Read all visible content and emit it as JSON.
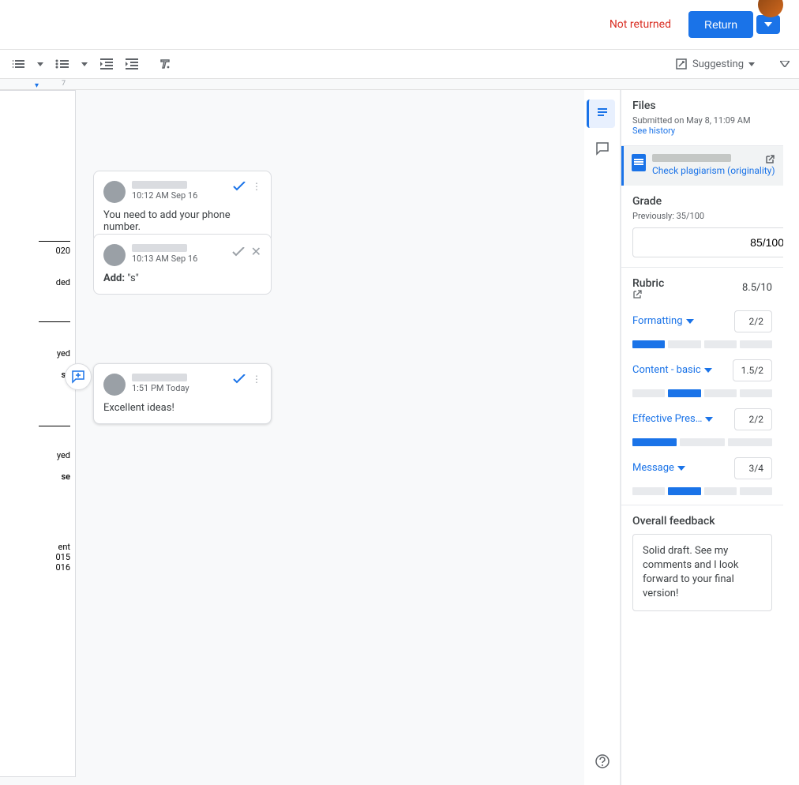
{
  "header": {
    "not_returned": "Not returned",
    "return_label": "Return"
  },
  "toolbar": {
    "suggesting_label": "Suggesting"
  },
  "ruler": {
    "mark7": "7"
  },
  "doc_fragments": {
    "t1": "020",
    "t2": "ded",
    "t3": "yed",
    "t4": "se",
    "t5": "yed",
    "t6": "se",
    "t7a": "ent",
    "t7b": "015",
    "t7c": "016"
  },
  "comments": [
    {
      "time": "10:12 AM Sep 16",
      "body": "You need to add your phone number."
    },
    {
      "time": "10:13 AM Sep 16",
      "prefix": "Add:",
      "body": "\"s\""
    },
    {
      "time": "1:51 PM Today",
      "body": "Excellent ideas!"
    }
  ],
  "sidebar": {
    "files": {
      "heading": "Files",
      "submitted": "Submitted on May 8, 11:09 AM",
      "history_link": "See history",
      "plagiarism": "Check plagiarism (originality)"
    },
    "grade": {
      "heading": "Grade",
      "previously": "Previously: 35/100",
      "value": "85/100"
    },
    "rubric": {
      "heading": "Rubric",
      "total": "8.5/10",
      "criteria": [
        {
          "label": "Formatting",
          "score": "2/2",
          "segments": 4,
          "filled": [
            0
          ]
        },
        {
          "label": "Content - basic",
          "score": "1.5/2",
          "segments": 4,
          "filled": [
            1
          ]
        },
        {
          "label": "Effective Pres…",
          "score": "2/2",
          "segments": 3,
          "filled": [
            0
          ]
        },
        {
          "label": "Message",
          "score": "3/4",
          "segments": 4,
          "filled": [
            1
          ]
        }
      ]
    },
    "feedback": {
      "heading": "Overall feedback",
      "text": "Solid draft. See my comments and I look forward to your final version!"
    }
  }
}
